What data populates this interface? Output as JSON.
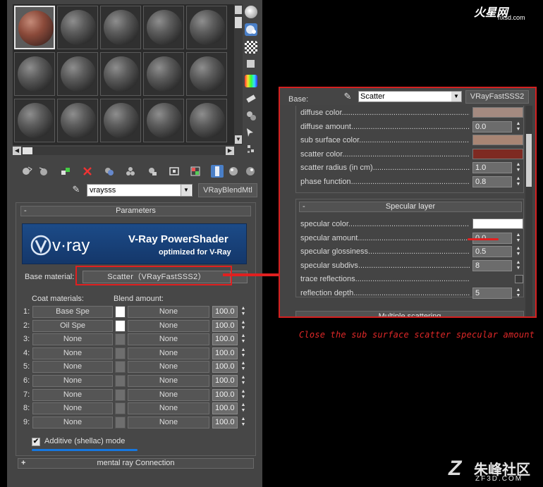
{
  "editor": {
    "slots": [
      "mars",
      "plain",
      "plain",
      "plain",
      "plain",
      "plain",
      "plain",
      "plain",
      "plain",
      "plain",
      "plain",
      "plain",
      "plain",
      "plain",
      "plain"
    ],
    "material_name": "vraysss",
    "material_type": "VRayBlendMtl",
    "rollout_title": "Parameters",
    "rollout_toggle": "-",
    "banner": {
      "logo": "v·ray",
      "title": "V-Ray PowerShader",
      "subtitle": "optimized for V-Ray"
    },
    "base_material_label": "Base material:",
    "base_material_value": "Scatter（VRayFastSSS2）",
    "coat_label": "Coat materials:",
    "blend_label": "Blend amount:",
    "coats": [
      {
        "num": "1:",
        "material": "Base Spe",
        "swatch": "white",
        "blend": "None",
        "amount": "100.0"
      },
      {
        "num": "2:",
        "material": "Oil Spe",
        "swatch": "white",
        "blend": "None",
        "amount": "100.0"
      },
      {
        "num": "3:",
        "material": "None",
        "swatch": "gray",
        "blend": "None",
        "amount": "100.0"
      },
      {
        "num": "4:",
        "material": "None",
        "swatch": "gray",
        "blend": "None",
        "amount": "100.0"
      },
      {
        "num": "5:",
        "material": "None",
        "swatch": "gray",
        "blend": "None",
        "amount": "100.0"
      },
      {
        "num": "6:",
        "material": "None",
        "swatch": "gray",
        "blend": "None",
        "amount": "100.0"
      },
      {
        "num": "7:",
        "material": "None",
        "swatch": "gray",
        "blend": "None",
        "amount": "100.0"
      },
      {
        "num": "8:",
        "material": "None",
        "swatch": "gray",
        "blend": "None",
        "amount": "100.0"
      },
      {
        "num": "9:",
        "material": "None",
        "swatch": "gray",
        "blend": "None",
        "amount": "100.0"
      }
    ],
    "additive_label": "Additive (shellac) mode",
    "additive_checked": true,
    "mental_ray_label": "mental ray Connection",
    "mental_ray_toggle": "+"
  },
  "zoom_panel": {
    "base_label": "Base:",
    "material_name": "Scatter",
    "material_type": "VRayFastSSS2",
    "group1": [
      {
        "label": "diffuse color",
        "kind": "swatch",
        "color": "#a48a80"
      },
      {
        "label": "diffuse amount",
        "kind": "value",
        "value": "0.0"
      },
      {
        "label": "sub surface color",
        "kind": "swatch",
        "color": "#a88574"
      },
      {
        "label": "scatter color",
        "kind": "swatch",
        "color": "#7e2a22"
      },
      {
        "label": "scatter radius (in cm)",
        "kind": "value",
        "value": "1.0"
      },
      {
        "label": "phase function",
        "kind": "value",
        "value": "0.8"
      }
    ],
    "group2_title": "Specular layer",
    "group2_toggle": "-",
    "group2": [
      {
        "label": "specular color",
        "kind": "swatch",
        "color": "#ffffff"
      },
      {
        "label": "specular amount",
        "kind": "value",
        "value": "0.0"
      },
      {
        "label": "specular glossiness",
        "kind": "value",
        "value": "0.5"
      },
      {
        "label": "specular subdivs",
        "kind": "value",
        "value": "8"
      },
      {
        "label": "trace reflections",
        "kind": "check",
        "value": ""
      },
      {
        "label": "reflection depth",
        "kind": "value",
        "value": "5"
      }
    ],
    "multiple_label": "Multiple scattering"
  },
  "annotation": "Close the sub surface scatter specular amount",
  "watermark_top": {
    "logo": "火星网",
    "site": "hxsd.com"
  },
  "watermark_bottom": {
    "cn": "朱峰社区",
    "en": "ZF3D.COM"
  },
  "colors": {
    "highlight": "#e02020",
    "underline": "#1677e0",
    "banner": "#1c4b88"
  }
}
